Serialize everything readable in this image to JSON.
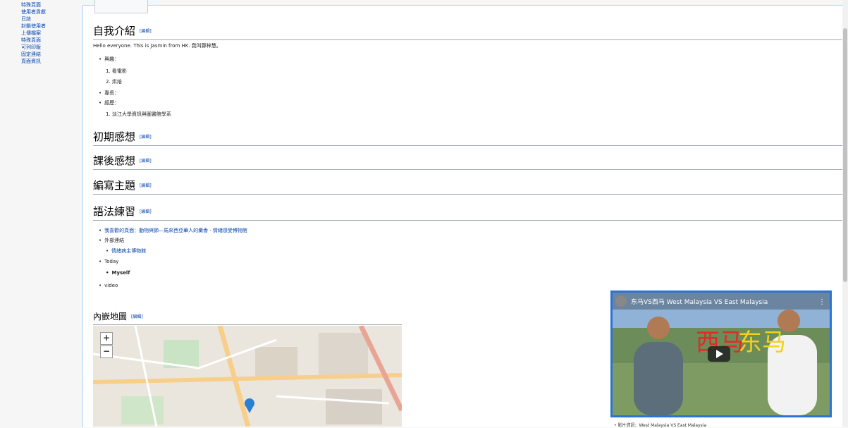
{
  "sidebar": {
    "items": [
      "特殊頁面",
      "使用者貢獻",
      "日誌",
      "封鎖使用者",
      "上傳檔案",
      "特殊頁面",
      "可列印版",
      "固定連結",
      "頁面資訊"
    ]
  },
  "edit_label": "[編輯]",
  "sections": [
    {
      "title": "自我介紹"
    },
    {
      "title": "初期感想"
    },
    {
      "title": "課後感想"
    },
    {
      "title": "編寫主題"
    },
    {
      "title": "語法練習"
    },
    {
      "title": "內嵌地圖"
    }
  ],
  "intro": {
    "text": "Hello everyone. This is Jasmin from HK. 我叫鄭梓慧。",
    "list": [
      {
        "label": "興趣："
      },
      {
        "label": "1. 看電影"
      },
      {
        "label": "2. 烘焙"
      },
      {
        "label": "專長："
      },
      {
        "label": "經歷："
      },
      {
        "label": "1. 淡江大學資訊與圖書館學系"
      }
    ]
  },
  "grammar": {
    "items": [
      {
        "label": "我喜歡的頁面：動物與節—馬來西亞華人的羹香 · 情緒感受博物館"
      },
      {
        "label": "外部連結"
      },
      {
        "label": "情緒病主博物館"
      },
      {
        "label": "Today"
      },
      {
        "label": "Myself"
      },
      {
        "label": "video"
      }
    ]
  },
  "map": {
    "zoom_in": "+",
    "zoom_out": "−"
  },
  "video": {
    "title": "东马VS西马 West Malaysia VS East Malaysia",
    "caption": "• 影片資訊：West Malaysia VS East Malaysia",
    "overlay_left": "西马",
    "overlay_right": "东马"
  },
  "colors": {
    "link": "#0645ad",
    "video_border": "#2b73d6"
  }
}
